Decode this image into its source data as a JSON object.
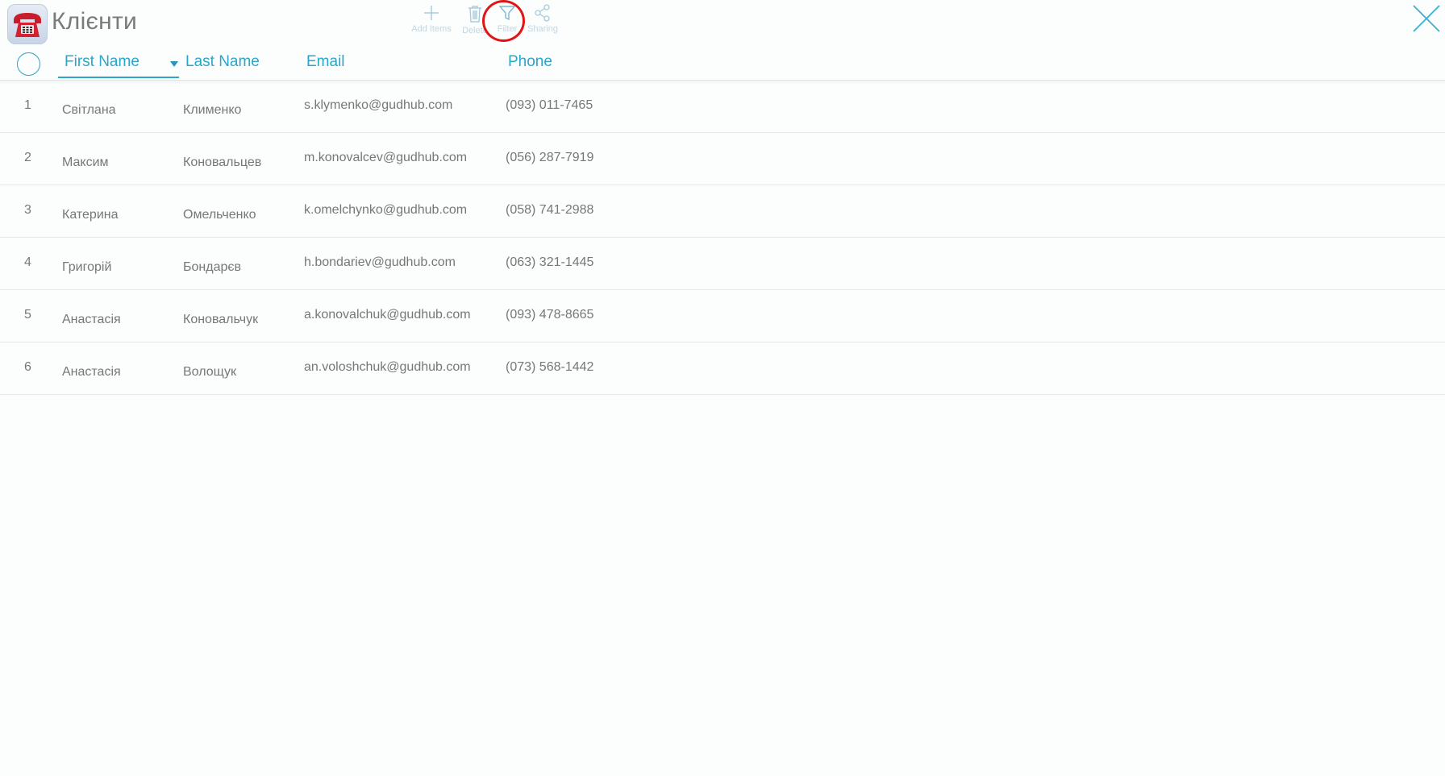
{
  "header": {
    "title": "Клієнти",
    "toolbar": {
      "add_label": "Add Items",
      "delete_label": "Delete",
      "filter_label": "Filter",
      "sharing_label": "Sharing"
    }
  },
  "columns": {
    "first_name": "First Name",
    "last_name": "Last Name",
    "email": "Email",
    "phone": "Phone"
  },
  "rows": [
    {
      "num": "1",
      "first": "Світлана",
      "last": "Клименко",
      "email": "s.klymenko@gudhub.com",
      "phone": "(093) 011-7465"
    },
    {
      "num": "2",
      "first": "Максим",
      "last": "Коновальцев",
      "email": "m.konovalcev@gudhub.com",
      "phone": "(056) 287-7919"
    },
    {
      "num": "3",
      "first": "Катерина",
      "last": "Омельченко",
      "email": "k.omelchynko@gudhub.com",
      "phone": "(058) 741-2988"
    },
    {
      "num": "4",
      "first": "Григорій",
      "last": "Бондарєв",
      "email": "h.bondariev@gudhub.com",
      "phone": "(063) 321-1445"
    },
    {
      "num": "5",
      "first": "Анастасія",
      "last": "Коновальчук",
      "email": "a.konovalchuk@gudhub.com",
      "phone": "(093) 478-8665"
    },
    {
      "num": "6",
      "first": "Анастасія",
      "last": "Волощук",
      "email": "an.voloshchuk@gudhub.com",
      "phone": "(073) 568-1442"
    }
  ],
  "colors": {
    "accent": "#2aa6c8",
    "highlight": "#e01515",
    "text": "#777777"
  },
  "icons": [
    "telephone-icon",
    "plus-icon",
    "trash-icon",
    "filter-icon",
    "share-icon",
    "close-icon"
  ]
}
